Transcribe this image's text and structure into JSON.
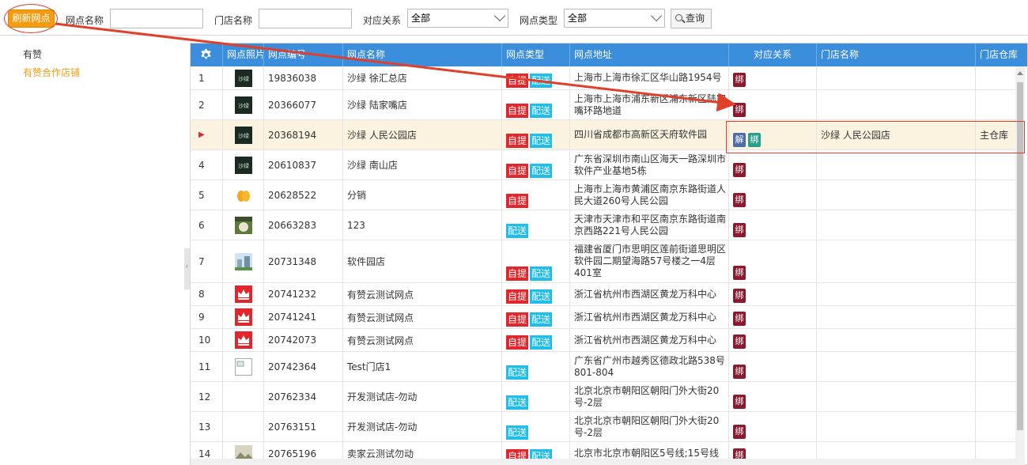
{
  "toolbar": {
    "refresh_label": "刷新网点",
    "site_name_label": "网点名称",
    "site_name_value": "",
    "store_name_label": "门店名称",
    "store_name_value": "",
    "relation_label": "对应关系",
    "relation_value": "全部",
    "site_type_label": "网点类型",
    "site_type_value": "全部",
    "query_label": "查询"
  },
  "tree": {
    "root": "有赞",
    "child": "有赞合作店铺"
  },
  "columns": [
    "网点照片",
    "网点编号",
    "网点名称",
    "网点类型",
    "网点地址",
    "对应关系",
    "门店名称",
    "门店仓库"
  ],
  "tags": {
    "pickup": "自提",
    "delivery": "配送",
    "bind": "绑",
    "unbind": "解"
  },
  "rows": [
    {
      "idx": "1",
      "code": "19836038",
      "name": "沙绿 徐汇总店",
      "pickup": true,
      "delivery": true,
      "address": "上海市上海市徐汇区华山路1954号",
      "store": "",
      "warehouse": "",
      "icon": "shalv-icon"
    },
    {
      "idx": "2",
      "code": "20366077",
      "name": "沙绿 陆家嘴店",
      "pickup": true,
      "delivery": true,
      "address": "上海市上海市浦东新区浦东新区陆家嘴环路地道",
      "store": "",
      "warehouse": "",
      "icon": "shalv-icon"
    },
    {
      "idx": "",
      "code": "20368194",
      "name": "沙绿 人民公园店",
      "pickup": true,
      "delivery": true,
      "address": "四川省成都市高新区天府软件园",
      "store": "沙绿 人民公园店",
      "warehouse": "主仓库",
      "icon": "shalv-icon",
      "selected": true
    },
    {
      "idx": "4",
      "code": "20610837",
      "name": "沙绿 南山店",
      "pickup": true,
      "delivery": true,
      "address": "广东省深圳市南山区海天一路深圳市软件产业基地5栋",
      "store": "",
      "warehouse": "",
      "icon": "shalv-icon"
    },
    {
      "idx": "5",
      "code": "20628522",
      "name": "分销",
      "pickup": true,
      "delivery": false,
      "address": "上海市上海市黄浦区南京东路街道人民大道260号人民公园",
      "store": "",
      "warehouse": "",
      "icon": "mango-icon"
    },
    {
      "idx": "6",
      "code": "20663283",
      "name": "123",
      "pickup": false,
      "delivery": true,
      "address": "天津市天津市和平区南京东路街道南京西路221号人民公园",
      "store": "",
      "warehouse": "",
      "icon": "food-photo-icon"
    },
    {
      "idx": "7",
      "code": "20731348",
      "name": "软件园店",
      "pickup": true,
      "delivery": true,
      "address": "福建省厦门市思明区莲前街道思明区软件园二期望海路57号楼之一4层401室",
      "store": "",
      "warehouse": "",
      "icon": "building-photo-icon"
    },
    {
      "idx": "8",
      "code": "20741232",
      "name": "有赞云测试网点",
      "pickup": true,
      "delivery": true,
      "address": "浙江省杭州市西湖区黄龙万科中心",
      "store": "",
      "warehouse": "",
      "icon": "crown-icon"
    },
    {
      "idx": "9",
      "code": "20741241",
      "name": "有赞云测试网点",
      "pickup": true,
      "delivery": true,
      "address": "浙江省杭州市西湖区黄龙万科中心",
      "store": "",
      "warehouse": "",
      "icon": "crown-icon"
    },
    {
      "idx": "10",
      "code": "20742073",
      "name": "有赞云测试网点",
      "pickup": true,
      "delivery": true,
      "address": "浙江省杭州市西湖区黄龙万科中心",
      "store": "",
      "warehouse": "",
      "icon": "crown-icon"
    },
    {
      "idx": "11",
      "code": "20742364",
      "name": "Test门店1",
      "pickup": false,
      "delivery": true,
      "address": "广东省广州市越秀区德政北路538号801-804",
      "store": "",
      "warehouse": "",
      "icon": "broken-image-icon"
    },
    {
      "idx": "12",
      "code": "20762334",
      "name": "开发测试店-勿动",
      "pickup": false,
      "delivery": true,
      "address": "北京北京市朝阳区朝阳门外大街20号-2层",
      "store": "",
      "warehouse": "",
      "icon": ""
    },
    {
      "idx": "13",
      "code": "20763151",
      "name": "开发测试店-勿动",
      "pickup": false,
      "delivery": true,
      "address": "北京北京市朝阳区朝阳门外大街20号-2层",
      "store": "",
      "warehouse": "",
      "icon": ""
    },
    {
      "idx": "14",
      "code": "20765196",
      "name": "卖家云测试勿动",
      "pickup": true,
      "delivery": true,
      "address": "北京市北京市朝阳区5号线;15号线",
      "store": "",
      "warehouse": "",
      "icon": "landscape-photo-icon"
    }
  ]
}
